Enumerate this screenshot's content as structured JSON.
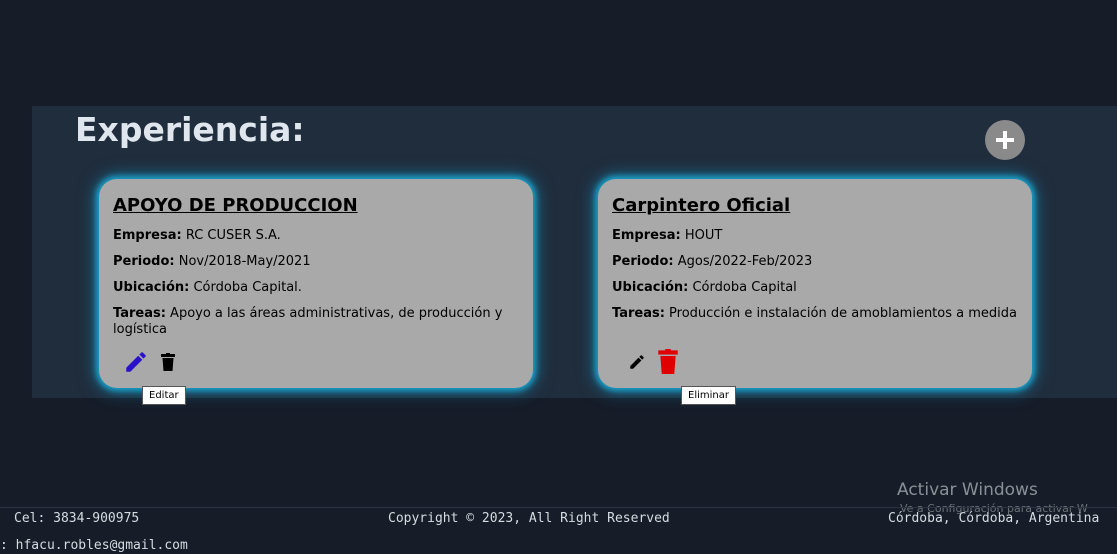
{
  "experience": {
    "title": "Experiencia:",
    "cards": [
      {
        "title": "APOYO DE PRODUCCION",
        "company_label": "Empresa:",
        "company": "RC CUSER S.A.",
        "period_label": "Periodo:",
        "period": "Nov/2018-May/2021",
        "location_label": "Ubicación:",
        "location": "Córdoba Capital.",
        "tasks_label": "Tareas:",
        "tasks": "Apoyo a las áreas administrativas, de producción y logística"
      },
      {
        "title": "Carpintero Oficial",
        "company_label": "Empresa:",
        "company": "HOUT",
        "period_label": "Periodo:",
        "period": "Agos/2022-Feb/2023",
        "location_label": "Ubicación:",
        "location": "Córdoba Capital",
        "tasks_label": "Tareas:",
        "tasks": "Producción e instalación de amoblamientos a medida"
      }
    ],
    "tooltips": {
      "edit": "Editar",
      "delete": "Eliminar"
    }
  },
  "colors": {
    "edit_active": "#2b10c9",
    "delete_active": "#e00000",
    "glow": "#1aa0c8"
  },
  "windows_watermark": {
    "title": "Activar Windows",
    "subtitle": "Ve a Configuración para activar W"
  },
  "footer": {
    "phone": "Cel: 3834-900975",
    "copyright": "Copyright © 2023, All Right Reserved",
    "location": "Córdoba, Córdoba, Argentina",
    "email": ": hfacu.robles@gmail.com"
  }
}
